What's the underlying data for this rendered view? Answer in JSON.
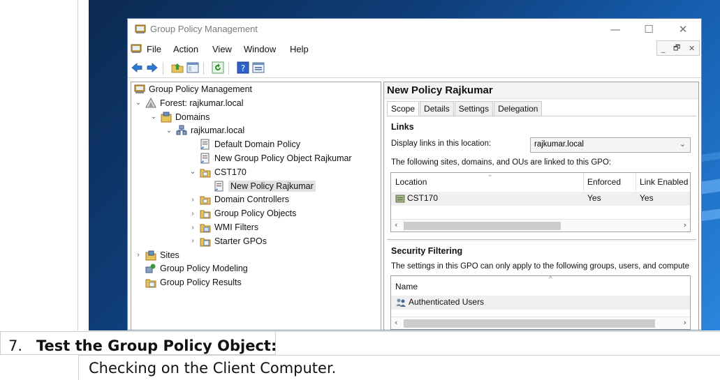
{
  "window": {
    "title": "Group Policy Management",
    "minimize_glyph": "—",
    "maximize_glyph": "☐",
    "close_glyph": "✕"
  },
  "menu": [
    "File",
    "Action",
    "View",
    "Window",
    "Help"
  ],
  "mdi_buttons": [
    "_",
    "🗗",
    "✕"
  ],
  "toolbar_icons": [
    "back-arrow-icon",
    "forward-arrow-icon",
    "up-folder-icon",
    "show-tree-icon",
    "refresh-icon",
    "help-icon",
    "properties-icon"
  ],
  "tree": [
    {
      "label": "Group Policy Management",
      "level": 0,
      "chevron": "",
      "icon": "gpm-icon"
    },
    {
      "label": "Forest: rajkumar.local",
      "level": 1,
      "chevron": "⌄",
      "icon": "forest-icon"
    },
    {
      "label": "Domains",
      "level": 2,
      "chevron": "⌄",
      "icon": "domains-icon"
    },
    {
      "label": "rajkumar.local",
      "level": 3,
      "chevron": "⌄",
      "icon": "domain-icon"
    },
    {
      "label": "Default Domain Policy",
      "level": 4,
      "chevron": "",
      "icon": "gpo-link-icon"
    },
    {
      "label": "New Group Policy Object Rajkumar",
      "level": 4,
      "chevron": "",
      "icon": "gpo-link-icon"
    },
    {
      "label": "CST170",
      "level": 4,
      "chevron": "⌄",
      "icon": "ou-folder-icon"
    },
    {
      "label": "New Policy Rajkumar",
      "level": 5,
      "chevron": "",
      "icon": "gpo-link-icon",
      "selected": true
    },
    {
      "label": "Domain Controllers",
      "level": 4,
      "chevron": "›",
      "icon": "ou-folder-icon"
    },
    {
      "label": "Group Policy Objects",
      "level": 4,
      "chevron": "›",
      "icon": "gpo-folder-icon"
    },
    {
      "label": "WMI Filters",
      "level": 4,
      "chevron": "›",
      "icon": "wmi-folder-icon"
    },
    {
      "label": "Starter GPOs",
      "level": 4,
      "chevron": "›",
      "icon": "starter-folder-icon"
    },
    {
      "label": "Sites",
      "level": 1,
      "chevron": "›",
      "icon": "sites-icon"
    },
    {
      "label": "Group Policy Modeling",
      "level": 1,
      "chevron": "",
      "icon": "modeling-icon"
    },
    {
      "label": "Group Policy Results",
      "level": 1,
      "chevron": "",
      "icon": "results-icon"
    }
  ],
  "detail": {
    "title": "New Policy Rajkumar",
    "tabs": [
      "Scope",
      "Details",
      "Settings",
      "Delegation"
    ],
    "links": {
      "heading": "Links",
      "display_label": "Display links in this location:",
      "location_value": "rajkumar.local",
      "linked_text": "The following sites, domains, and OUs are linked to this GPO:",
      "columns": [
        "Location",
        "Enforced",
        "Link Enabled"
      ],
      "rows": [
        {
          "location": "CST170",
          "enforced": "Yes",
          "link_enabled": "Yes"
        }
      ]
    },
    "security": {
      "heading": "Security Filtering",
      "desc": "The settings in this GPO can only apply to the following groups, users, and compute",
      "columns": [
        "Name"
      ],
      "rows": [
        "Authenticated Users"
      ]
    }
  },
  "doc": {
    "step_number": "7.",
    "step_title": "Test the Group Policy Object:",
    "paragraph": "Checking on the Client Computer."
  }
}
